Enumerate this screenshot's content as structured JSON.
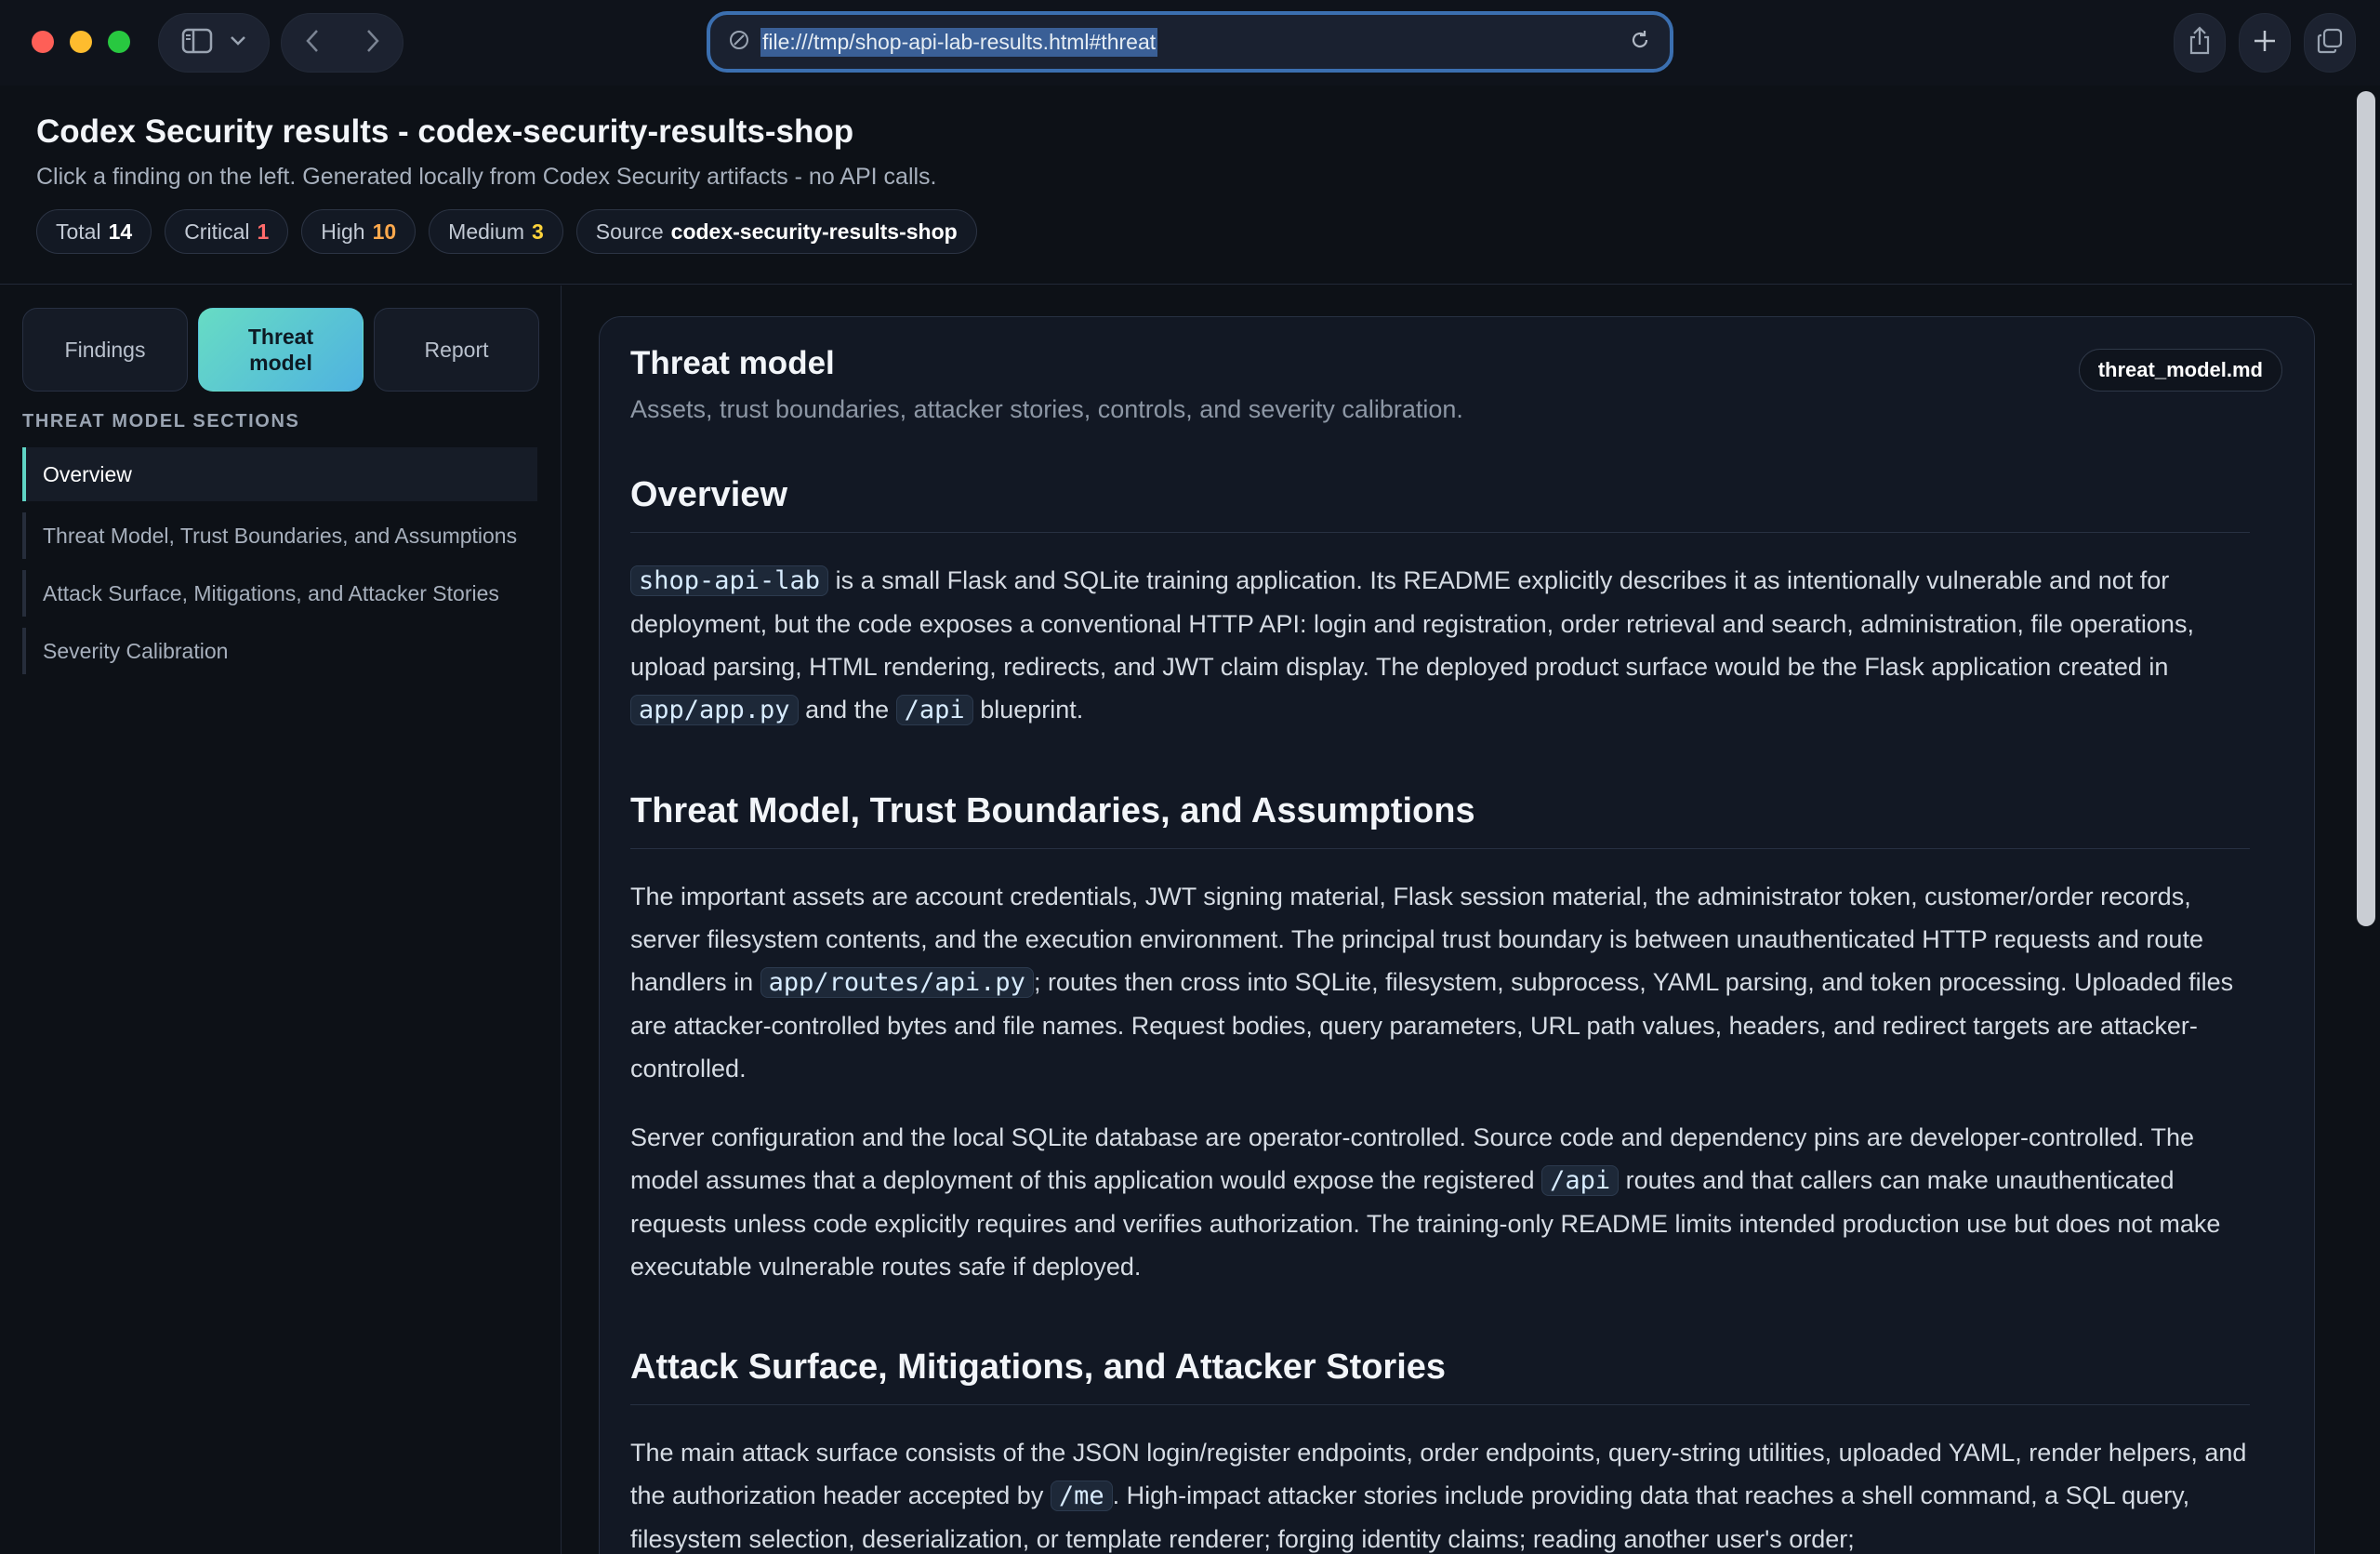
{
  "browser": {
    "url": "file:///tmp/shop-api-lab-results.html#threat"
  },
  "header": {
    "title": "Codex Security results - codex-security-results-shop",
    "subtitle": "Click a finding on the left. Generated locally from Codex Security artifacts - no API calls.",
    "chips": {
      "total_label": "Total",
      "total_value": "14",
      "critical_label": "Critical",
      "critical_value": "1",
      "high_label": "High",
      "high_value": "10",
      "medium_label": "Medium",
      "medium_value": "3",
      "source_label": "Source",
      "source_value": "codex-security-results-shop"
    }
  },
  "sidebar": {
    "tabs": {
      "findings": "Findings",
      "threat_model": "Threat model",
      "report": "Report"
    },
    "section_heading": "THREAT MODEL SECTIONS",
    "items": [
      "Overview",
      "Threat Model, Trust Boundaries, and Assumptions",
      "Attack Surface, Mitigations, and Attacker Stories",
      "Severity Calibration"
    ]
  },
  "panel": {
    "title": "Threat model",
    "subtitle": "Assets, trust boundaries, attacker stories, controls, and severity calibration.",
    "file_badge": "threat_model.md",
    "overview": {
      "heading": "Overview",
      "code_1": "shop-api-lab",
      "text_1": " is a small Flask and SQLite training application. Its README explicitly describes it as intentionally vulnerable and not for deployment, but the code exposes a conventional HTTP API: login and registration, order retrieval and search, administration, file operations, upload parsing, HTML rendering, redirects, and JWT claim display. The deployed product surface would be the Flask application created in ",
      "code_2": "app/app.py",
      "text_2": " and the ",
      "code_3": "/api",
      "text_3": " blueprint."
    },
    "threat_model": {
      "heading": "Threat Model, Trust Boundaries, and Assumptions",
      "p1_text_1": "The important assets are account credentials, JWT signing material, Flask session material, the administrator token, customer/order records, server filesystem contents, and the execution environment. The principal trust boundary is between unauthenticated HTTP requests and route handlers in ",
      "p1_code_1": "app/routes/api.py",
      "p1_text_2": "; routes then cross into SQLite, filesystem, subprocess, YAML parsing, and token processing. Uploaded files are attacker-controlled bytes and file names. Request bodies, query parameters, URL path values, headers, and redirect targets are attacker-controlled.",
      "p2_text_1": "Server configuration and the local SQLite database are operator-controlled. Source code and dependency pins are developer-controlled. The model assumes that a deployment of this application would expose the registered ",
      "p2_code_1": "/api",
      "p2_text_2": " routes and that callers can make unauthenticated requests unless code explicitly requires and verifies authorization. The training-only README limits intended production use but does not make executable vulnerable routes safe if deployed."
    },
    "attack_surface": {
      "heading": "Attack Surface, Mitigations, and Attacker Stories",
      "text_1": "The main attack surface consists of the JSON login/register endpoints, order endpoints, query-string utilities, uploaded YAML, render helpers, and the authorization header accepted by ",
      "code_1": "/me",
      "text_2": ". High-impact attacker stories include providing data that reaches a shell command, a SQL query, filesystem selection, deserialization, or template renderer; forging identity claims; reading another user's order;"
    }
  }
}
